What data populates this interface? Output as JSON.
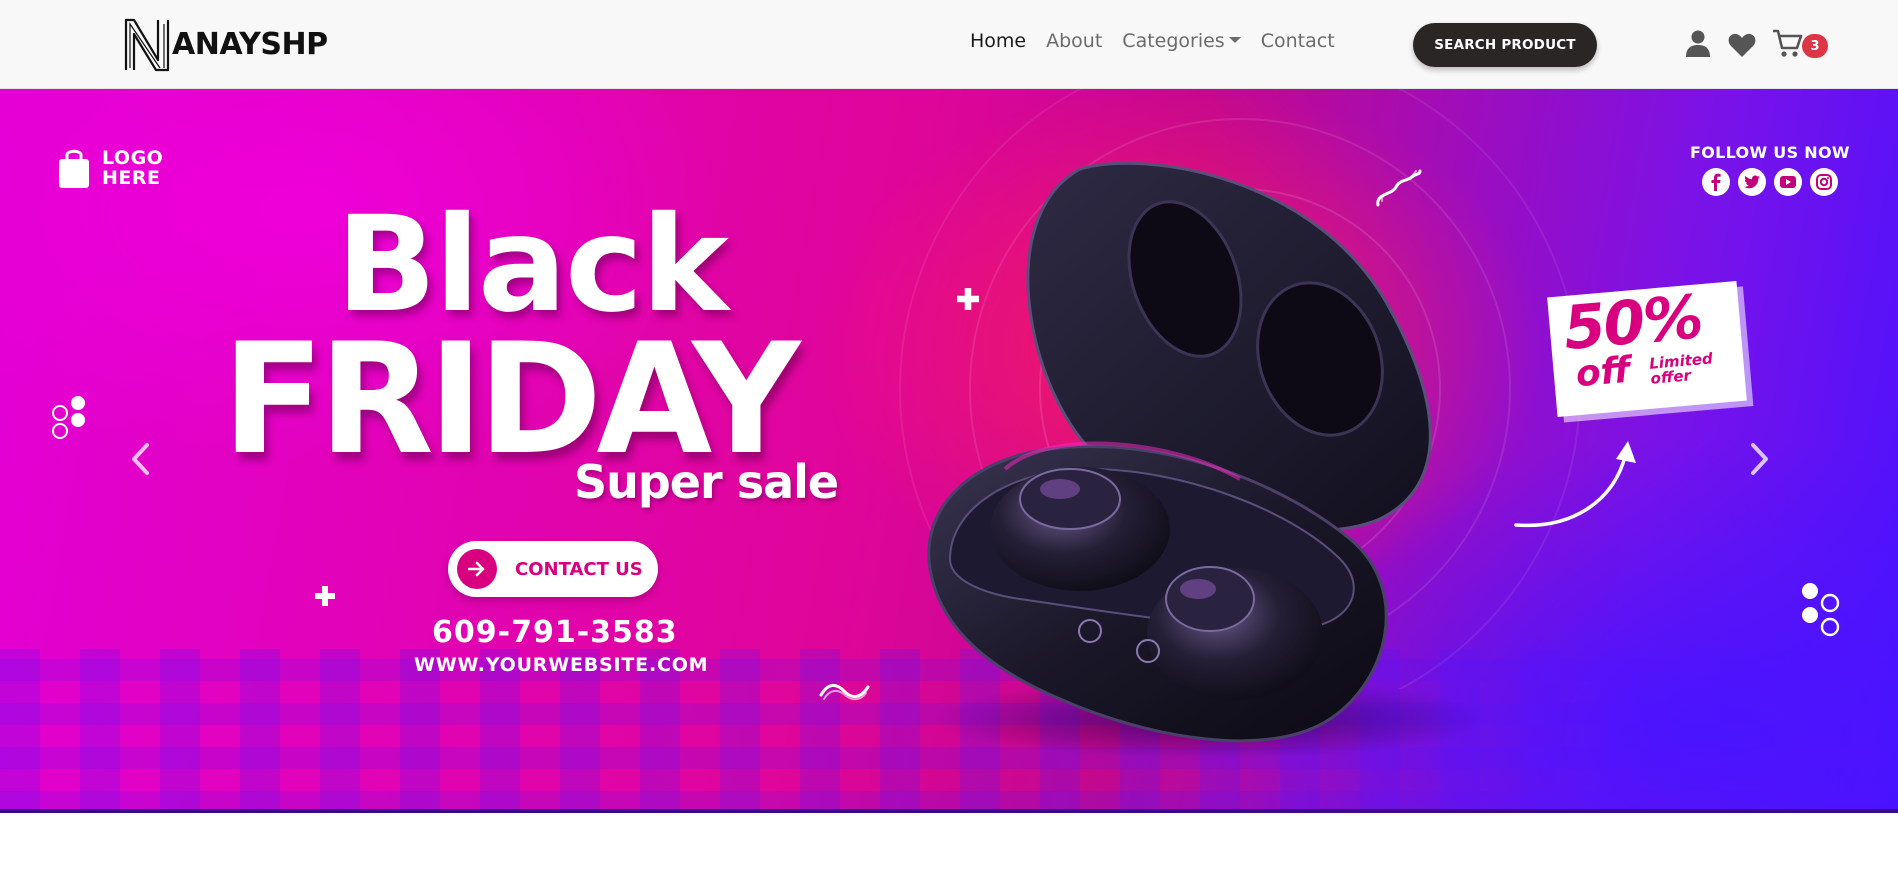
{
  "header": {
    "brand_name": "ANAYSHP",
    "nav": [
      {
        "label": "Home",
        "active": true
      },
      {
        "label": "About",
        "active": false
      },
      {
        "label": "Categories",
        "active": false,
        "dropdown": true
      },
      {
        "label": "Contact",
        "active": false
      }
    ],
    "search_button": "SEARCH PRODUCT",
    "icons": [
      "user-icon",
      "heart-icon",
      "cart-icon"
    ],
    "cart_count": "3",
    "badge_color": "#dc3545"
  },
  "banner": {
    "logo_text": "LOGO\nHERE",
    "follow_title": "FOLLOW US NOW",
    "social_icons": [
      "facebook-icon",
      "twitter-icon",
      "youtube-icon",
      "instagram-icon"
    ],
    "headline_1": "Black",
    "headline_2": "FRIDAY",
    "headline_3": "Super sale",
    "cta_label": "CONTACT US",
    "phone": "609-791-3583",
    "website": "WWW.YOURWEBSITE.COM",
    "discount": "50%",
    "discount_off": "off",
    "discount_note": "Limited\noffer",
    "accent_color": "#d8007f",
    "controls": [
      "prev-arrow",
      "next-arrow"
    ]
  }
}
